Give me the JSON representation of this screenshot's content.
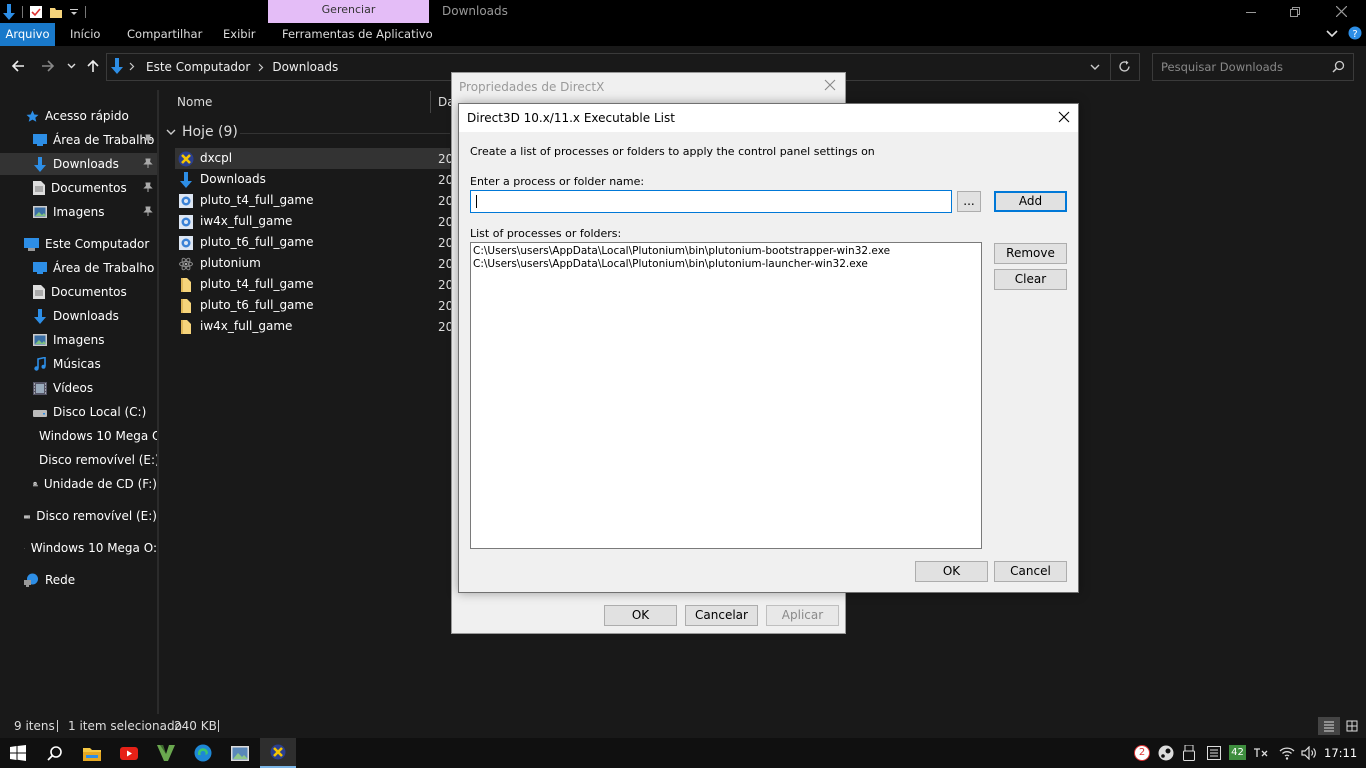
{
  "explorer": {
    "context_tab": "Gerenciar",
    "window_title": "Downloads",
    "ribbon_tabs": [
      "Arquivo",
      "Início",
      "Compartilhar",
      "Exibir",
      "Ferramentas de Aplicativo"
    ],
    "address": {
      "root": "Este Computador",
      "folder": "Downloads"
    },
    "search_placeholder": "Pesquisar Downloads",
    "sidebar": [
      "Acesso rápido",
      "Área de Trabalho",
      "Downloads",
      "Documentos",
      "Imagens",
      "Este Computador",
      "Área de Trabalho",
      "Documentos",
      "Downloads",
      "Imagens",
      "Músicas",
      "Vídeos",
      "Disco Local (C:)",
      "Windows 10 Mega O",
      "Disco removível (E:)",
      "Unidade de CD (F:)",
      "Disco removível (E:)",
      "Windows 10 Mega O:",
      "Rede"
    ],
    "columns": {
      "name": "Nome",
      "date": "Da"
    },
    "group": "Hoje (9)",
    "files": [
      {
        "name": "dxcpl",
        "date": "20"
      },
      {
        "name": "Downloads",
        "date": "20"
      },
      {
        "name": "pluto_t4_full_game",
        "date": "20"
      },
      {
        "name": "iw4x_full_game",
        "date": "20"
      },
      {
        "name": "pluto_t6_full_game",
        "date": "20"
      },
      {
        "name": "plutonium",
        "date": "20"
      },
      {
        "name": "pluto_t4_full_game",
        "date": "20"
      },
      {
        "name": "pluto_t6_full_game",
        "date": "20"
      },
      {
        "name": "iw4x_full_game",
        "date": "20"
      }
    ],
    "status": {
      "count": "9 itens",
      "selection": "1 item selecionado",
      "size": "240 KB"
    }
  },
  "dx_dialog": {
    "title": "Propriedades de DirectX",
    "ok": "OK",
    "cancel": "Cancelar",
    "apply": "Aplicar"
  },
  "exec_dialog": {
    "title": "Direct3D 10.x/11.x Executable List",
    "description": "Create a list of processes or folders to apply the control panel settings on",
    "input_label": "Enter a process or folder name:",
    "input_value": "",
    "browse": "...",
    "add": "Add",
    "list_label": "List of processes or folders:",
    "items": [
      "C:\\Users\\users\\AppData\\Local\\Plutonium\\bin\\plutonium-bootstrapper-win32.exe",
      "C:\\Users\\users\\AppData\\Local\\Plutonium\\bin\\plutonium-launcher-win32.exe"
    ],
    "remove": "Remove",
    "clear": "Clear",
    "ok": "OK",
    "cancel": "Cancel"
  },
  "taskbar": {
    "clock": "17:11",
    "badge": "2",
    "temp": "42"
  }
}
